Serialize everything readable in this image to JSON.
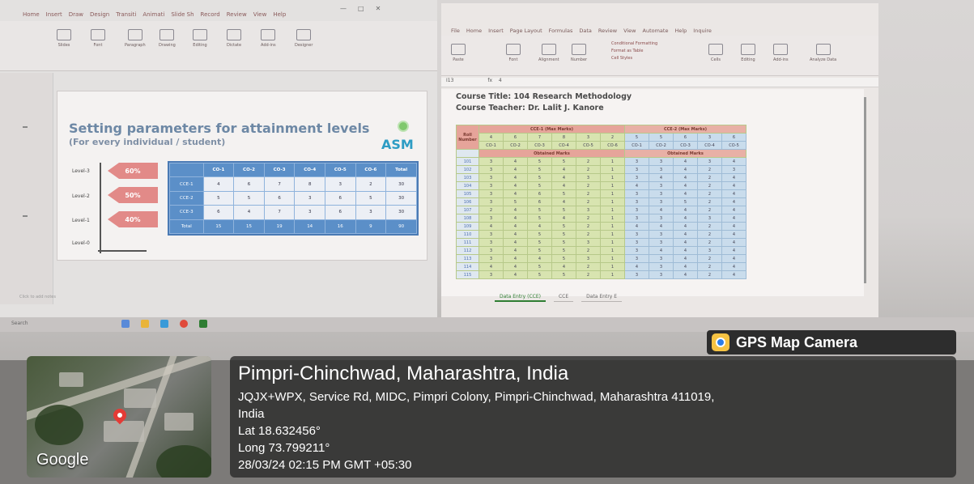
{
  "powerpoint": {
    "tabs": [
      "Home",
      "Insert",
      "Draw",
      "Design",
      "Transiti",
      "Animati",
      "Slide Sh",
      "Record",
      "Review",
      "View",
      "Help"
    ],
    "ribbon_buttons": [
      "Slides",
      "Font",
      "Paragraph",
      "Drawing",
      "Editing",
      "Dictate",
      "Add-ins",
      "Designer"
    ],
    "slide": {
      "title": "Setting parameters for attainment levels",
      "subtitle": "(For every individual / student)",
      "brand": "ASM",
      "levels": [
        {
          "label": "Level-3",
          "percent": "60%"
        },
        {
          "label": "Level-2",
          "percent": "50%"
        },
        {
          "label": "Level-1",
          "percent": "40%"
        },
        {
          "label": "Level-0"
        }
      ],
      "table": {
        "headers": [
          "",
          "CO-1",
          "CO-2",
          "CO-3",
          "CO-4",
          "CO-5",
          "CO-6",
          "Total"
        ],
        "rows": [
          [
            "CCE-1",
            "4",
            "6",
            "7",
            "8",
            "3",
            "2",
            "30"
          ],
          [
            "CCE-2",
            "5",
            "5",
            "6",
            "3",
            "6",
            "5",
            "30"
          ],
          [
            "CCE-3",
            "6",
            "4",
            "7",
            "3",
            "6",
            "3",
            "30"
          ],
          [
            "Total",
            "15",
            "15",
            "19",
            "14",
            "16",
            "9",
            "90"
          ]
        ]
      }
    },
    "status": "Click to add notes"
  },
  "excel": {
    "tabs": [
      "File",
      "Home",
      "Insert",
      "Page Layout",
      "Formulas",
      "Data",
      "Review",
      "View",
      "Automate",
      "Help",
      "Inquire"
    ],
    "ribbon_buttons": [
      "Paste",
      "Font",
      "Alignment",
      "Number",
      "Cells",
      "Editing",
      "Add-ins",
      "Analyze Data"
    ],
    "styles_menu": [
      "Conditional Formatting",
      "Format as Table",
      "Cell Styles"
    ],
    "name_box": "I13",
    "formula_value": "4",
    "course_title": "Course Title: 104 Research Methodology",
    "course_teacher": "Course Teacher: Dr. Lalit J. Kanore",
    "roll_header": "Roll Number",
    "cce1_header": "CCE-1 (Max Marks)",
    "cce2_header": "CCE-2 (Max Marks)",
    "cce1_max": [
      "4",
      "6",
      "7",
      "8",
      "3",
      "2"
    ],
    "cce2_max": [
      "5",
      "5",
      "6",
      "3",
      "6"
    ],
    "co_labels": [
      "CO-1",
      "CO-2",
      "CO-3",
      "CO-4",
      "CO-5",
      "CO-6"
    ],
    "obtained_label": "Obtained Marks",
    "rolls": [
      "101",
      "102",
      "103",
      "104",
      "105",
      "106",
      "107",
      "108",
      "109",
      "110",
      "111",
      "112",
      "113",
      "114",
      "115"
    ],
    "marks1": [
      [
        "3",
        "4",
        "5",
        "5",
        "2",
        "1"
      ],
      [
        "3",
        "4",
        "5",
        "4",
        "2",
        "1"
      ],
      [
        "3",
        "4",
        "5",
        "4",
        "3",
        "1"
      ],
      [
        "3",
        "4",
        "5",
        "4",
        "2",
        "1"
      ],
      [
        "3",
        "4",
        "6",
        "5",
        "2",
        "1"
      ],
      [
        "3",
        "5",
        "6",
        "4",
        "2",
        "1"
      ],
      [
        "2",
        "4",
        "5",
        "5",
        "3",
        "1"
      ],
      [
        "3",
        "4",
        "5",
        "4",
        "2",
        "1"
      ],
      [
        "4",
        "4",
        "4",
        "5",
        "2",
        "1"
      ],
      [
        "3",
        "4",
        "5",
        "5",
        "2",
        "1"
      ],
      [
        "3",
        "4",
        "5",
        "5",
        "3",
        "1"
      ],
      [
        "3",
        "4",
        "5",
        "5",
        "2",
        "1"
      ],
      [
        "3",
        "4",
        "4",
        "5",
        "3",
        "1"
      ],
      [
        "4",
        "4",
        "5",
        "4",
        "2",
        "1"
      ],
      [
        "3",
        "4",
        "5",
        "5",
        "2",
        "1"
      ]
    ],
    "marks2": [
      [
        "3",
        "3",
        "4",
        "3",
        "4"
      ],
      [
        "3",
        "3",
        "4",
        "2",
        "3"
      ],
      [
        "3",
        "4",
        "4",
        "2",
        "4"
      ],
      [
        "4",
        "3",
        "4",
        "2",
        "4"
      ],
      [
        "3",
        "3",
        "4",
        "2",
        "4"
      ],
      [
        "3",
        "3",
        "5",
        "2",
        "4"
      ],
      [
        "3",
        "4",
        "4",
        "2",
        "4"
      ],
      [
        "3",
        "3",
        "4",
        "3",
        "4"
      ],
      [
        "4",
        "4",
        "4",
        "2",
        "4"
      ],
      [
        "3",
        "3",
        "4",
        "2",
        "4"
      ],
      [
        "3",
        "3",
        "4",
        "2",
        "4"
      ],
      [
        "3",
        "4",
        "4",
        "3",
        "4"
      ],
      [
        "3",
        "3",
        "4",
        "2",
        "4"
      ],
      [
        "4",
        "3",
        "4",
        "2",
        "4"
      ],
      [
        "3",
        "3",
        "4",
        "2",
        "4"
      ]
    ],
    "sheet_tabs": [
      "Data Entry (CCE)",
      "CCE",
      "Data Entry E"
    ]
  },
  "taskbar": {
    "search": "Search"
  },
  "gps": {
    "app_title": "GPS Map Camera",
    "city": "Pimpri-Chinchwad, Maharashtra, India",
    "address_line1": "JQJX+WPX, Service Rd, MIDC, Pimpri Colony, Pimpri-Chinchwad, Maharashtra 411019,",
    "address_line2": "India",
    "lat": "Lat 18.632456°",
    "long": "Long 73.799211°",
    "datetime": "28/03/24 02:15 PM GMT +05:30",
    "map_label": "Google"
  },
  "colors": {
    "arrow_red": "#e28a88",
    "header_red": "#e6a49a",
    "cell_green": "#d8e4b0",
    "cell_blue": "#c9dcec",
    "gps_pin": "#e43b36",
    "gps_badge_icon": "#f6c343"
  }
}
